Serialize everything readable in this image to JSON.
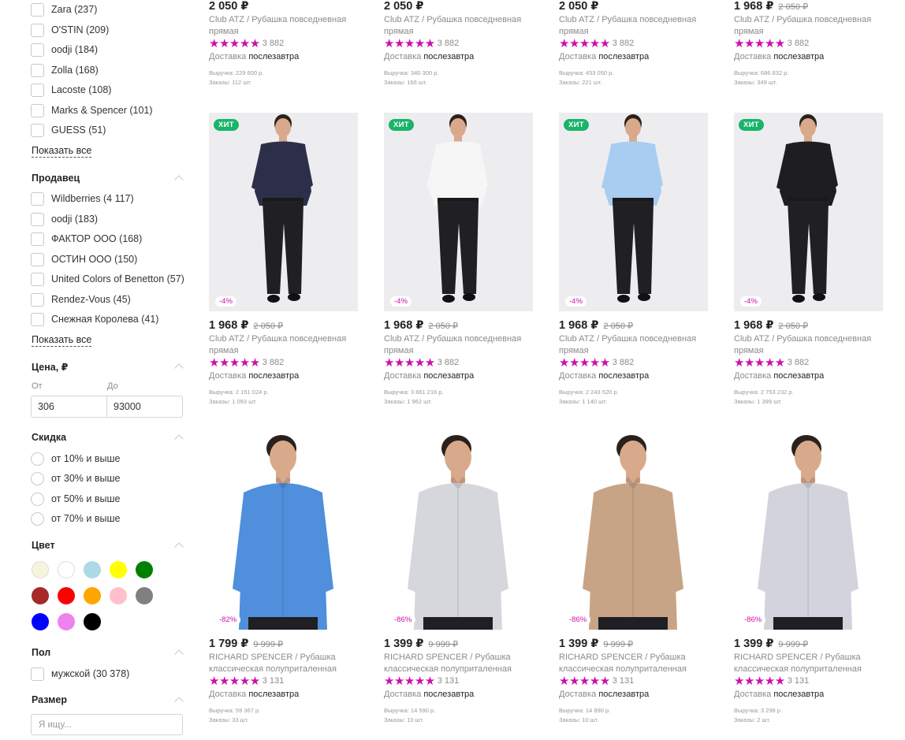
{
  "filters": {
    "brands": [
      "Zara (237)",
      "O'STIN (209)",
      "oodji (184)",
      "Zolla (168)",
      "Lacoste (108)",
      "Marks & Spencer (101)",
      "GUESS (51)"
    ],
    "brand_show_all": "Показать все",
    "seller_title": "Продавец",
    "sellers": [
      "Wildberries (4 117)",
      "oodji (183)",
      "ФАКТОР ООО (168)",
      "ОСТИН ООО (150)",
      "United Colors of Benetton (57)",
      "Rendez-Vous (45)",
      "Снежная Королева (41)"
    ],
    "seller_show_all": "Показать все",
    "price_title": "Цена, ₽",
    "price_from_label": "От",
    "price_to_label": "До",
    "price_from": "306",
    "price_to": "93000",
    "discount_title": "Скидка",
    "discounts": [
      "от 10% и выше",
      "от 30% и выше",
      "от 50% и выше",
      "от 70% и выше"
    ],
    "color_title": "Цвет",
    "colors": [
      "#f5f5dc",
      "#ffffff",
      "#add8e6",
      "#ffff00",
      "#008000",
      "#a52a2a",
      "#ff0000",
      "#ffa500",
      "#ffc0cb",
      "#808080",
      "#0000ff",
      "#ee82ee",
      "#000000"
    ],
    "gender_title": "Пол",
    "genders": [
      "мужской (30 378)"
    ],
    "size_title": "Размер",
    "size_search_placeholder": "Я ищу..."
  },
  "products_top": [
    {
      "price": "2 050 ₽",
      "old": "",
      "name": "Club ATZ / Рубашка повседневная прямая",
      "rating": "3 882",
      "delivery_prefix": "Доставка",
      "delivery_day": "послезавтра",
      "revenue": "Выручка: 229 600 р.",
      "orders": "Заказы: 112 шт."
    },
    {
      "price": "2 050 ₽",
      "old": "",
      "name": "Club ATZ / Рубашка повседневная прямая",
      "rating": "3 882",
      "delivery_prefix": "Доставка",
      "delivery_day": "послезавтра",
      "revenue": "Выручка: 340 300 р.",
      "orders": "Заказы: 166 шт."
    },
    {
      "price": "2 050 ₽",
      "old": "",
      "name": "Club ATZ / Рубашка повседневная прямая",
      "rating": "3 882",
      "delivery_prefix": "Доставка",
      "delivery_day": "послезавтра",
      "revenue": "Выручка: 453 050 р.",
      "orders": "Заказы: 221 шт."
    },
    {
      "price": "1 968 ₽",
      "old": "2 050 ₽",
      "name": "Club ATZ / Рубашка повседневная прямая",
      "rating": "3 882",
      "delivery_prefix": "Доставка",
      "delivery_day": "послезавтра",
      "revenue": "Выручка: 686 832 р.",
      "orders": "Заказы: 349 шт."
    }
  ],
  "products_mid": [
    {
      "badge": "ХИТ",
      "discount": "-4%",
      "price": "1 968 ₽",
      "old": "2 050 ₽",
      "name": "Club ATZ / Рубашка повседневная прямая",
      "rating": "3 882",
      "delivery_prefix": "Доставка",
      "delivery_day": "послезавтра",
      "revenue": "Выручка: 2 151 024 р.",
      "orders": "Заказы: 1 093 шт.",
      "shirt": "#2d2f4a"
    },
    {
      "badge": "ХИТ",
      "discount": "-4%",
      "price": "1 968 ₽",
      "old": "2 050 ₽",
      "name": "Club ATZ / Рубашка повседневная прямая",
      "rating": "3 882",
      "delivery_prefix": "Доставка",
      "delivery_day": "послезавтра",
      "revenue": "Выручка: 3 861 216 р.",
      "orders": "Заказы: 1 962 шт.",
      "shirt": "#f6f6f6"
    },
    {
      "badge": "ХИТ",
      "discount": "-4%",
      "price": "1 968 ₽",
      "old": "2 050 ₽",
      "name": "Club ATZ / Рубашка повседневная прямая",
      "rating": "3 882",
      "delivery_prefix": "Доставка",
      "delivery_day": "послезавтра",
      "revenue": "Выручка: 2 243 520 р.",
      "orders": "Заказы: 1 140 шт.",
      "shirt": "#a9cdf1"
    },
    {
      "badge": "ХИТ",
      "discount": "-4%",
      "price": "1 968 ₽",
      "old": "2 050 ₽",
      "name": "Club ATZ / Рубашка повседневная прямая",
      "rating": "3 882",
      "delivery_prefix": "Доставка",
      "delivery_day": "послезавтра",
      "revenue": "Выручка: 2 753 232 р.",
      "orders": "Заказы: 1 399 шт.",
      "shirt": "#1e1e22"
    }
  ],
  "products_bottom": [
    {
      "discount": "-82%",
      "price": "1 799 ₽",
      "old": "9 999 ₽",
      "name": "RICHARD SPENCER / Рубашка классическая полуприталенная",
      "rating": "3 131",
      "delivery_prefix": "Доставка",
      "delivery_day": "послезавтра",
      "revenue": "Выручка: 59 367 р.",
      "orders": "Заказы: 33 шт.",
      "shirt": "#4f8fdc"
    },
    {
      "discount": "-86%",
      "price": "1 399 ₽",
      "old": "9 999 ₽",
      "name": "RICHARD SPENCER / Рубашка классическая полуприталенная",
      "rating": "3 131",
      "delivery_prefix": "Доставка",
      "delivery_day": "послезавтра",
      "revenue": "Выручка: 14 590 р.",
      "orders": "Заказы: 10 шт.",
      "shirt": "#d6d6dd"
    },
    {
      "discount": "-86%",
      "price": "1 399 ₽",
      "old": "9 999 ₽",
      "name": "RICHARD SPENCER / Рубашка классическая полуприталенная",
      "rating": "3 131",
      "delivery_prefix": "Доставка",
      "delivery_day": "послезавтра",
      "revenue": "Выручка: 14 890 р.",
      "orders": "Заказы: 10 шт.",
      "shirt": "#c8a486"
    },
    {
      "discount": "-86%",
      "price": "1 399 ₽",
      "old": "9 999 ₽",
      "name": "RICHARD SPENCER / Рубашка классическая полуприталенная",
      "rating": "3 131",
      "delivery_prefix": "Доставка",
      "delivery_day": "послезавтра",
      "revenue": "Выручка: 3 298 р.",
      "orders": "Заказы: 2 шт.",
      "shirt": "#d2d3dc"
    }
  ],
  "stars": "★★★★★",
  "accent_color": "#cb11ab",
  "hit_color": "#19b469"
}
